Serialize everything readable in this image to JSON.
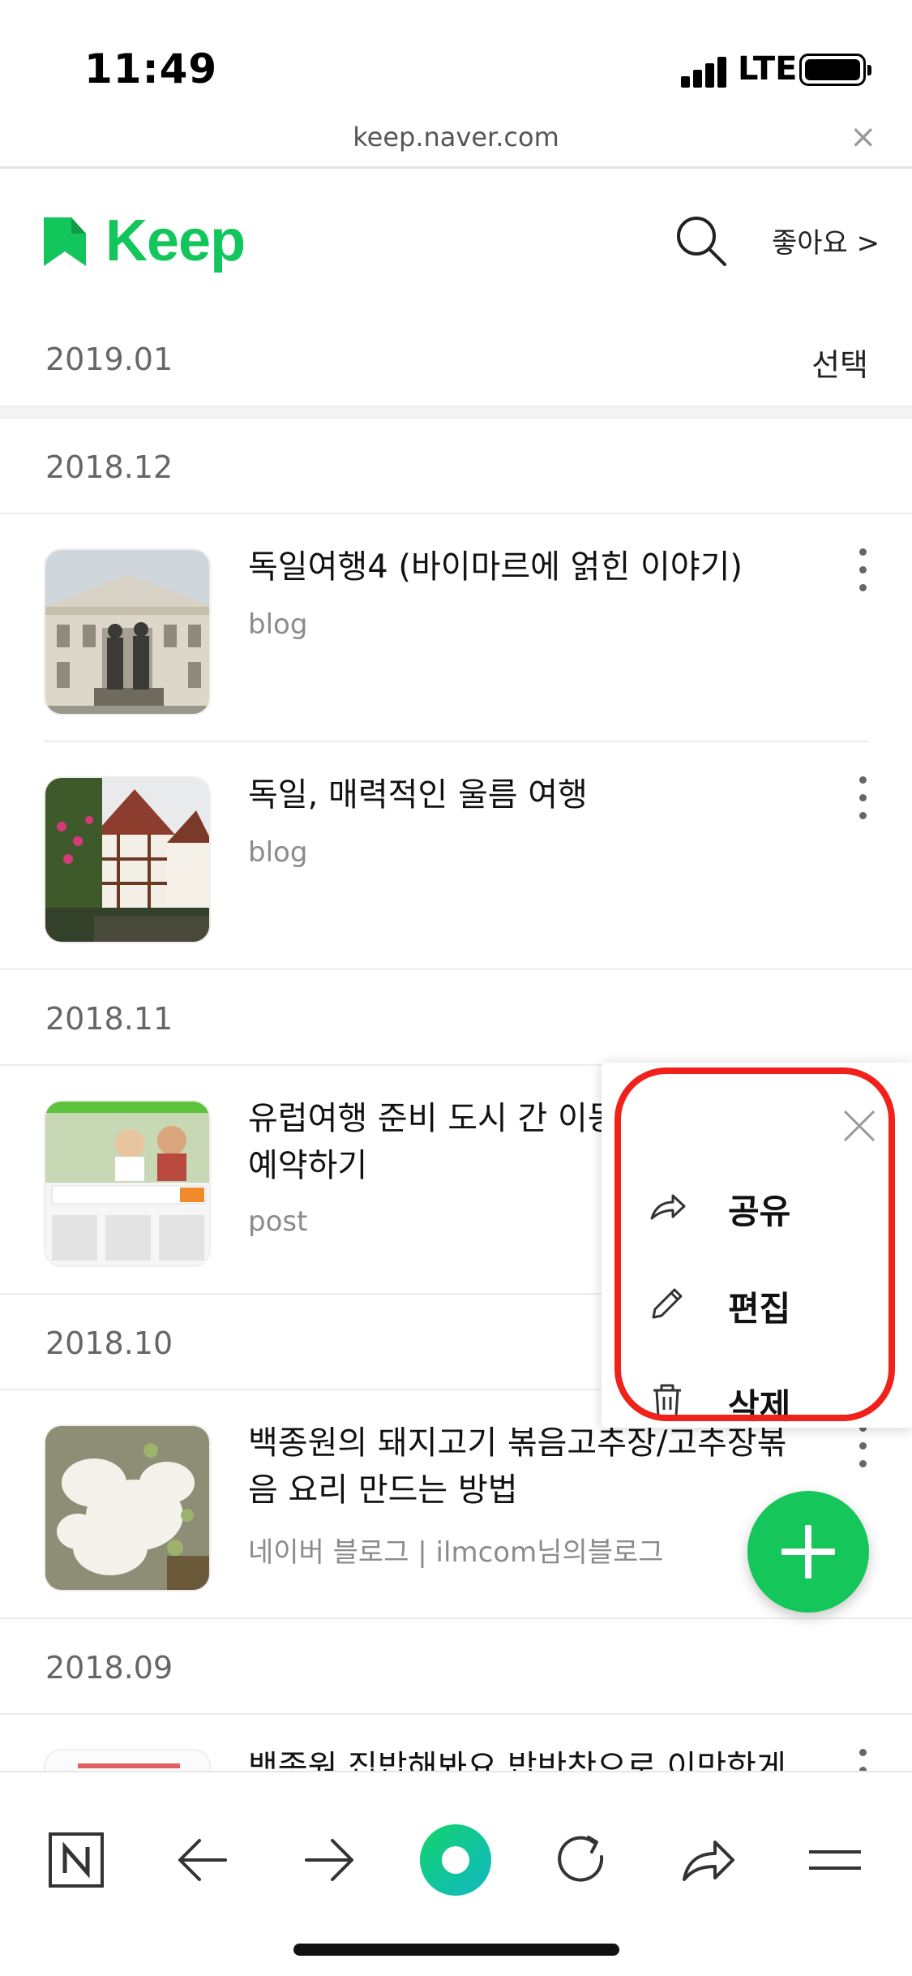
{
  "status_bar": {
    "time": "11:49",
    "network": "LTE"
  },
  "browser": {
    "url": "keep.naver.com",
    "close_icon": "close-icon"
  },
  "header": {
    "app_name": "Keep",
    "likes_label": "좋아요 >"
  },
  "select_label": "선택",
  "groups": [
    {
      "date": "2019.01",
      "items": []
    },
    {
      "date": "2018.12",
      "items": [
        {
          "title": "독일여행4 (바이마르에 얽힌 이야기)",
          "source": "blog"
        },
        {
          "title": "독일, 매력적인 울름 여행",
          "source": "blog"
        }
      ]
    },
    {
      "date": "2018.11",
      "items": [
        {
          "title": "유럽여행 준비 도시 간 이동",
          "title_line2": "예약하기",
          "source": "post"
        }
      ]
    },
    {
      "date": "2018.10",
      "items": [
        {
          "title": "백종원의 돼지고기 볶음고추장/고추장볶",
          "title_line2": "음 요리 만드는 방법",
          "source": "네이버 블로그 | ilmcom님의블로그"
        }
      ]
    },
    {
      "date": "2018.09",
      "items": [
        {
          "title": "백종원 집밥해봐요 밥반찬으로 이만한게"
        }
      ]
    }
  ],
  "popup": {
    "items": [
      {
        "label": "공유",
        "icon": "share-icon"
      },
      {
        "label": "편집",
        "icon": "pencil-icon"
      },
      {
        "label": "삭제",
        "icon": "trash-icon"
      }
    ]
  },
  "fab": {
    "icon": "plus-icon"
  },
  "toolbar": {
    "items": [
      "naver-home-icon",
      "back-arrow-icon",
      "forward-arrow-icon",
      "green-dot-icon",
      "refresh-icon",
      "share-arrow-icon",
      "menu-icon"
    ]
  },
  "colors": {
    "brand_green": "#13c65b",
    "highlight_red": "#f0211a",
    "text_gray": "#8b8b8b"
  }
}
